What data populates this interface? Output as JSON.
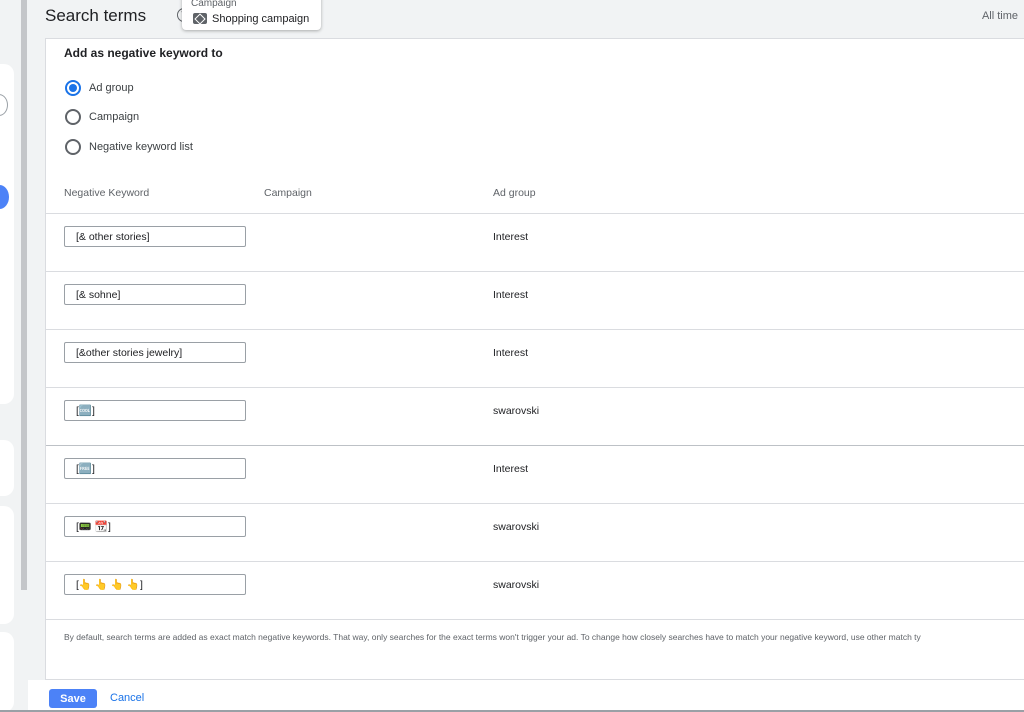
{
  "header": {
    "title": "Search terms",
    "campaign_chip": {
      "label": "Campaign",
      "value": "Shopping campaign"
    },
    "date_range": "All time"
  },
  "panel": {
    "title": "Add as negative keyword to",
    "options": [
      {
        "label": "Ad group",
        "checked": true
      },
      {
        "label": "Campaign",
        "checked": false
      },
      {
        "label": "Negative keyword list",
        "checked": false
      }
    ],
    "columns": [
      "Negative Keyword",
      "Campaign",
      "Ad group"
    ],
    "rows": [
      {
        "keyword": "[& other stories]",
        "campaign": "",
        "ad_group": "Interest"
      },
      {
        "keyword": "[& sohne]",
        "campaign": "",
        "ad_group": "Interest"
      },
      {
        "keyword": "[&other stories jewelry]",
        "campaign": "",
        "ad_group": "Interest"
      },
      {
        "keyword": "[🆒]",
        "campaign": "",
        "ad_group": "swarovski"
      },
      {
        "keyword": "[🆓]",
        "campaign": "",
        "ad_group": "Interest"
      },
      {
        "keyword": "[📟 📆]",
        "campaign": "",
        "ad_group": "swarovski"
      },
      {
        "keyword": "[👆 👆 👆 👆]",
        "campaign": "",
        "ad_group": "swarovski"
      }
    ],
    "footnote": "By default, search terms are added as exact match negative keywords. That way, only searches for the exact terms won't trigger your ad. To change how closely searches have to match your negative keyword, use other match ty"
  },
  "footer": {
    "save_label": "Save",
    "cancel_label": "Cancel"
  },
  "colors": {
    "accent": "#1a73e8",
    "save_button": "#4c82f7",
    "text": "#202124",
    "muted": "#5f6368"
  }
}
